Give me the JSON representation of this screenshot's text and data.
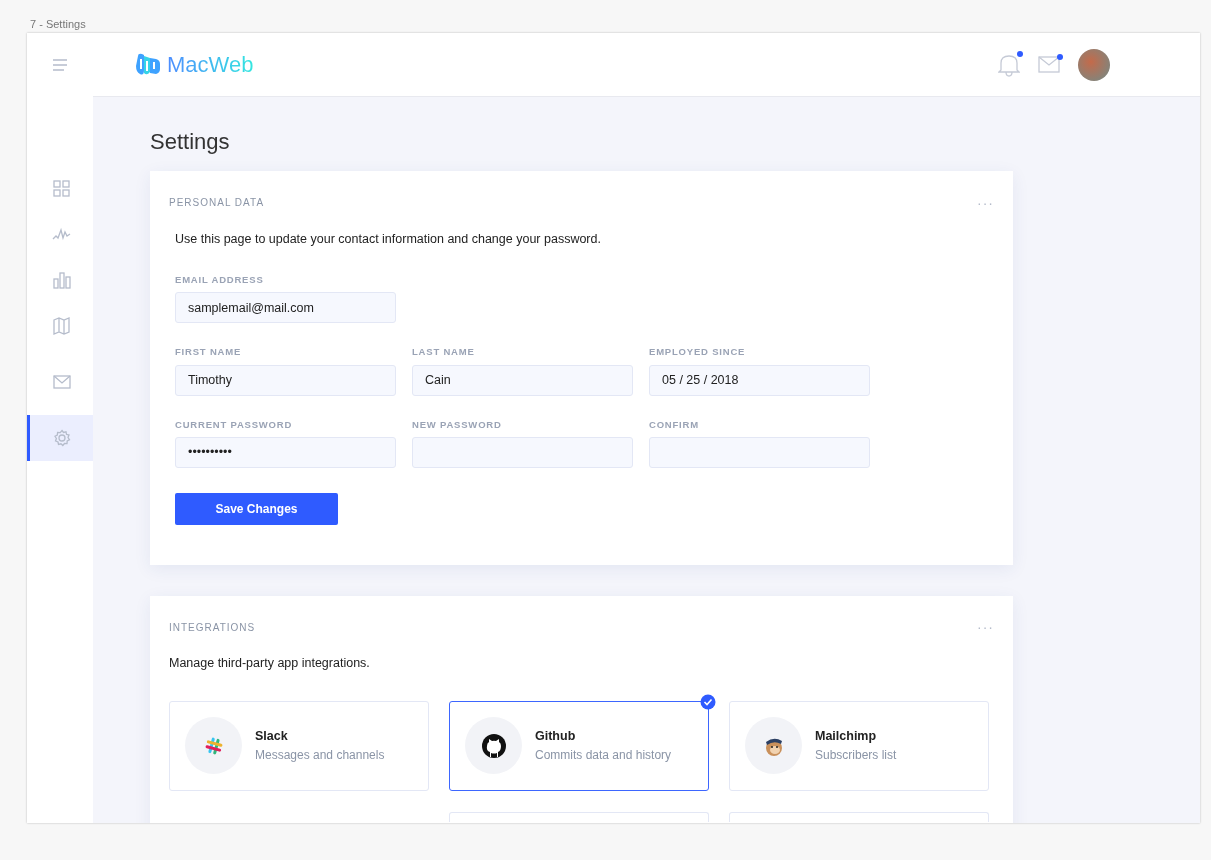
{
  "caption": "7 - Settings",
  "sidebar": {
    "items": [
      {
        "selected": false
      },
      {
        "selected": false
      },
      {
        "selected": false
      },
      {
        "selected": false
      },
      {
        "selected": false
      },
      {
        "selected": true
      }
    ]
  },
  "header": {
    "logo": "MacWeb",
    "notifications_unread": true,
    "messages_unread": true
  },
  "page_title": "Settings",
  "personal_data": {
    "title": "PERSONAL DATA",
    "more_button": "···",
    "description": "Use this page to update your contact information and change your password.",
    "rows": [
      [
        {
          "label": "EMAIL ADDRESS",
          "value": "samplemail@mail.com"
        }
      ],
      [
        {
          "label": "FIRST NAME",
          "value": "Timothy"
        },
        {
          "label": "LAST NAME",
          "value": "Cain"
        },
        {
          "label": "EMPLOYED SINCE",
          "value": "05 / 25 / 2018"
        }
      ],
      [
        {
          "label": "CURRENT PASSWORD",
          "value": "••••••••••"
        },
        {
          "label": "NEW PASSWORD"
        },
        {
          "label": "CONFIRM"
        }
      ]
    ],
    "save_button": "Save Changes"
  },
  "integrations": {
    "title": "INTEGRATIONS",
    "more_button": "···",
    "description": "Manage third-party app integrations.",
    "items": [
      {
        "name": "Slack",
        "description": "Messages and channels",
        "selected": false
      },
      {
        "name": "Github",
        "description": "Commits data and history",
        "selected": true
      },
      {
        "name": "Mailchimp",
        "description": "Subscribers list",
        "selected": false
      }
    ]
  }
}
